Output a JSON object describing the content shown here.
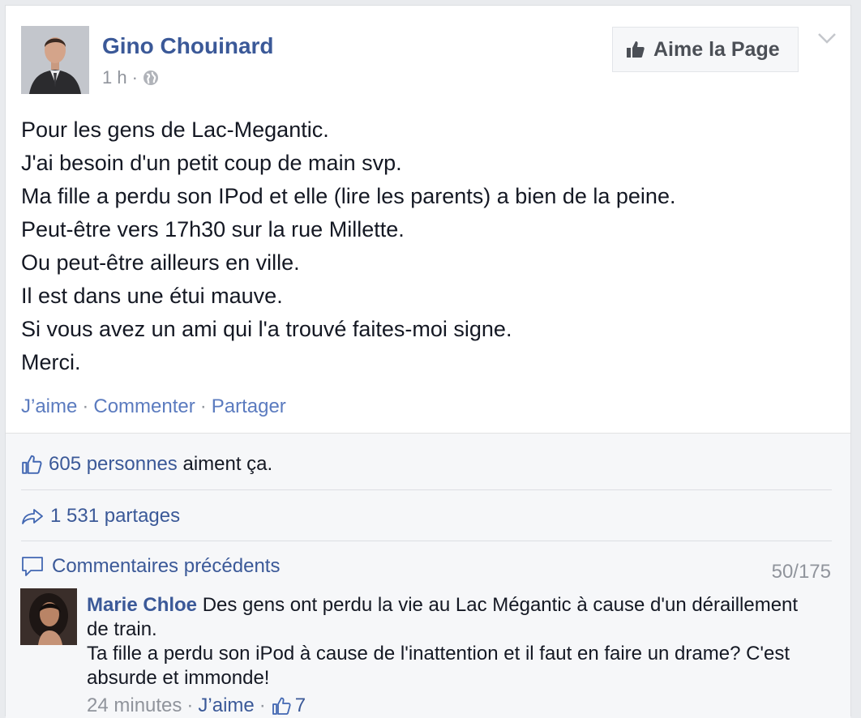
{
  "post": {
    "author": "Gino Chouinard",
    "time": "1 h",
    "dot": "·",
    "like_page_label": "Aime la Page",
    "lines": [
      "Pour les gens de Lac-Megantic.",
      "J'ai besoin d'un petit coup de main svp.",
      "Ma fille a perdu son IPod et elle (lire les parents) a bien de la peine.",
      "Peut-être vers 17h30 sur la rue Millette.",
      "Ou peut-être ailleurs en ville.",
      "Il est dans une étui mauve.",
      "Si vous avez un ami qui l'a trouvé faites-moi signe.",
      "Merci."
    ],
    "actions": {
      "like": "J’aime",
      "comment": "Commenter",
      "share": "Partager",
      "sep": "·"
    }
  },
  "ufi": {
    "likes_link": "605 personnes",
    "likes_suffix": "aiment ça.",
    "shares": "1 531 partages",
    "previous_comments": "Commentaires précédents",
    "comment_count": "50/175"
  },
  "comment": {
    "author": "Marie Chloe",
    "text1": "Des gens ont perdu la vie au Lac Mégantic à cause d'un déraillement de train.",
    "text2": "Ta fille a perdu son iPod à cause de l'inattention et il faut en faire un drame? C'est absurde et immonde!",
    "time": "24 minutes",
    "like": "J’aime",
    "sep": "·",
    "like_count": "7"
  },
  "colors": {
    "link": "#3b5998",
    "muted": "#90949c",
    "ufi_bg": "#f6f7f9"
  }
}
